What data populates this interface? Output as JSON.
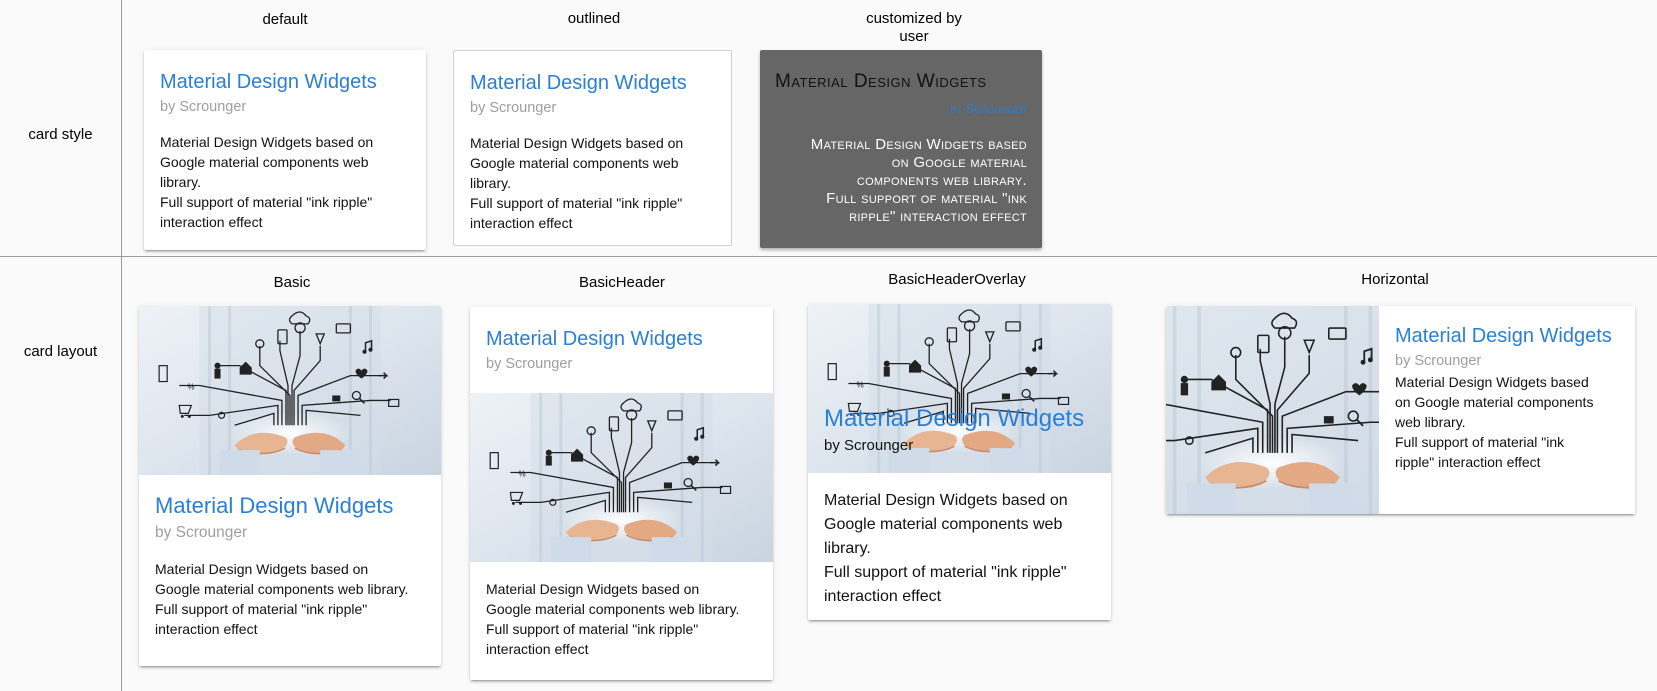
{
  "rows": {
    "style_label": "card style",
    "layout_label": "card layout"
  },
  "columns": {
    "default": "default",
    "outlined": "outlined",
    "custom_line1": "customized by",
    "custom_line2": "user",
    "basic": "Basic",
    "basic_header": "BasicHeader",
    "basic_header_overlay": "BasicHeaderOverlay",
    "horizontal": "Horizontal"
  },
  "card": {
    "title": "Material Design Widgets",
    "subtitle": "by Scrounger",
    "body_line1": "Material Design Widgets based on",
    "body_line2": "Google material components web",
    "body_line3": "library.",
    "body_line4": "Full support of material \"ink ripple\"",
    "body_line5": "interaction effect"
  },
  "basic_card": {
    "line1": "Material Design Widgets based on",
    "line2": "Google material components web library.",
    "line3": "Full support of material \"ink ripple\"",
    "line4": "interaction effect"
  },
  "custom_card": {
    "line1": "Material Design Widgets based",
    "line2": "on Google material",
    "line3": "components web library.",
    "line4": "Full support of material \"ink",
    "line5": "ripple\" interaction effect"
  },
  "horizontal_card": {
    "line1": "Material Design Widgets based",
    "line2": "on Google material components",
    "line3": "web library.",
    "line4": "Full support of material \"ink",
    "line5": "ripple\" interaction effect"
  },
  "media": {
    "icon": "tech-hands-illustration"
  },
  "colors": {
    "accent": "#2a7fd4",
    "subtitle": "#9e9e9e",
    "custom_bg": "#666666"
  }
}
